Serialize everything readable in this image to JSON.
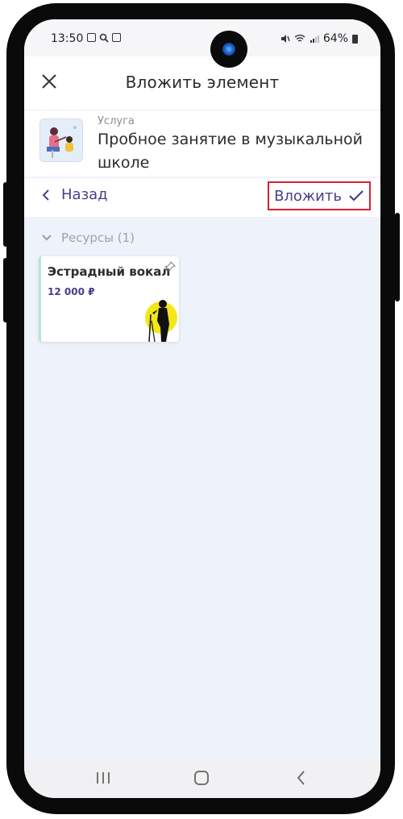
{
  "status_bar": {
    "time": "13:50",
    "battery": "64%",
    "icons": [
      "gallery-icon",
      "search-icon",
      "record-icon",
      "mute-icon",
      "wifi-icon",
      "signal-icon",
      "battery-icon"
    ]
  },
  "header": {
    "title": "Вложить элемент",
    "close_icon": "close-icon"
  },
  "service": {
    "kind": "Услуга",
    "name": "Пробное занятие в музыкальной школе"
  },
  "actions": {
    "back_label": "Назад",
    "attach_label": "Вложить",
    "accent": "#4a3f87",
    "highlight": "#d9212f"
  },
  "section": {
    "label": "Ресурсы (1)"
  },
  "resources": [
    {
      "name": "Эстрадный вокал",
      "price": "12 000 ₽"
    }
  ],
  "nav": {
    "recent_icon": "recent-apps-icon",
    "home_icon": "home-icon",
    "back_icon": "back-icon"
  }
}
